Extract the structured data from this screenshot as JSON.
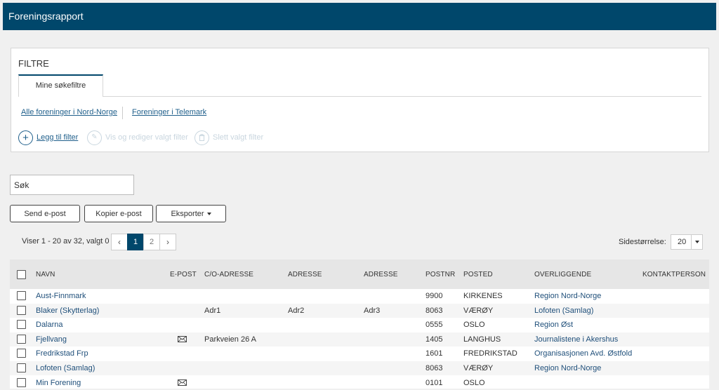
{
  "header": {
    "title": "Foreningsrapport"
  },
  "filters": {
    "title": "FILTRE",
    "tab_label": "Mine søkefiltre",
    "saved": [
      "Alle foreninger i Nord-Norge",
      "Foreninger i Telemark"
    ],
    "actions": {
      "add": "Legg til filter",
      "edit": "Vis og rediger valgt filter",
      "delete": "Slett valgt filter"
    }
  },
  "search": {
    "placeholder": "Søk"
  },
  "toolbar": {
    "send_email": "Send e-post",
    "copy_email": "Kopier e-post",
    "export": "Eksporter"
  },
  "paging": {
    "info": "Viser 1 - 20 av 32, valgt 0",
    "pages": [
      "1",
      "2"
    ],
    "prev": "‹",
    "next": "›",
    "page_size_label": "Sidestørrelse:",
    "page_size": "20"
  },
  "table": {
    "columns": [
      "NAVN",
      "E-POST",
      "C/O-ADRESSE",
      "ADRESSE",
      "ADRESSE",
      "POSTNR",
      "POSTED",
      "OVERLIGGENDE",
      "KONTAKTPERSON"
    ],
    "rows": [
      {
        "navn": "Aust-Finnmark",
        "epost": false,
        "co": "",
        "adr1": "",
        "adr2": "",
        "postnr": "9900",
        "posted": "KIRKENES",
        "overliggende": "Region Nord-Norge",
        "kontakt": ""
      },
      {
        "navn": "Blaker (Skytterlag)",
        "epost": false,
        "co": "Adr1",
        "adr1": "Adr2",
        "adr2": "Adr3",
        "postnr": "8063",
        "posted": "VÆRØY",
        "overliggende": "Lofoten (Samlag)",
        "kontakt": ""
      },
      {
        "navn": "Dalarna",
        "epost": false,
        "co": "",
        "adr1": "",
        "adr2": "",
        "postnr": "0555",
        "posted": "OSLO",
        "overliggende": "Region Øst",
        "kontakt": ""
      },
      {
        "navn": "Fjellvang",
        "epost": true,
        "co": "Parkveien 26 A",
        "adr1": "",
        "adr2": "",
        "postnr": "1405",
        "posted": "LANGHUS",
        "overliggende": "Journalistene i Akershus",
        "kontakt": ""
      },
      {
        "navn": "Fredrikstad Frp",
        "epost": false,
        "co": "",
        "adr1": "",
        "adr2": "",
        "postnr": "1601",
        "posted": "FREDRIKSTAD",
        "overliggende": "Organisasjonen Avd. Østfold",
        "kontakt": ""
      },
      {
        "navn": "Lofoten (Samlag)",
        "epost": false,
        "co": "",
        "adr1": "",
        "adr2": "",
        "postnr": "8063",
        "posted": "VÆRØY",
        "overliggende": "Region Nord-Norge",
        "kontakt": ""
      },
      {
        "navn": "Min Forening",
        "epost": true,
        "co": "",
        "adr1": "",
        "adr2": "",
        "postnr": "0101",
        "posted": "OSLO",
        "overliggende": "",
        "kontakt": ""
      }
    ]
  },
  "colors": {
    "brand": "#00476b",
    "link": "#1f5f8b"
  }
}
